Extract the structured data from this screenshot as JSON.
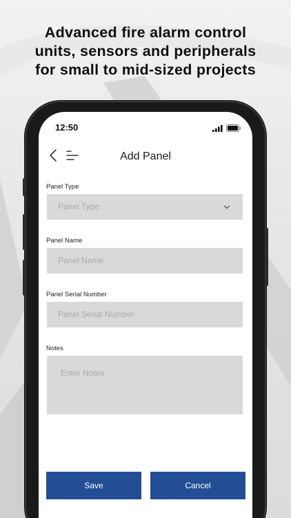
{
  "headline": {
    "line1": "Advanced fire alarm control",
    "line2": "units, sensors and peripherals",
    "line3": "for small to mid-sized projects"
  },
  "status_bar": {
    "time": "12:50",
    "icons": [
      "signal-icon",
      "battery-icon"
    ]
  },
  "nav": {
    "title": "Add Panel",
    "back_icon": "chevron-left-icon",
    "menu_icon": "menu-icon"
  },
  "form": {
    "panel_type": {
      "label": "Panel Type",
      "placeholder": "Panel Type",
      "icon": "chevron-down-icon"
    },
    "panel_name": {
      "label": "Panel Name",
      "placeholder": "Panel Name"
    },
    "serial_number": {
      "label": "Panel Serial Number",
      "placeholder": "Panel Serial Number"
    },
    "notes": {
      "label": "Notes",
      "placeholder": "Enter Notes"
    }
  },
  "actions": {
    "save_label": "Save",
    "cancel_label": "Cancel"
  },
  "colors": {
    "primary_button": "#234e96",
    "field_background": "#d9d9d9",
    "placeholder_text": "#a9a9a9"
  }
}
